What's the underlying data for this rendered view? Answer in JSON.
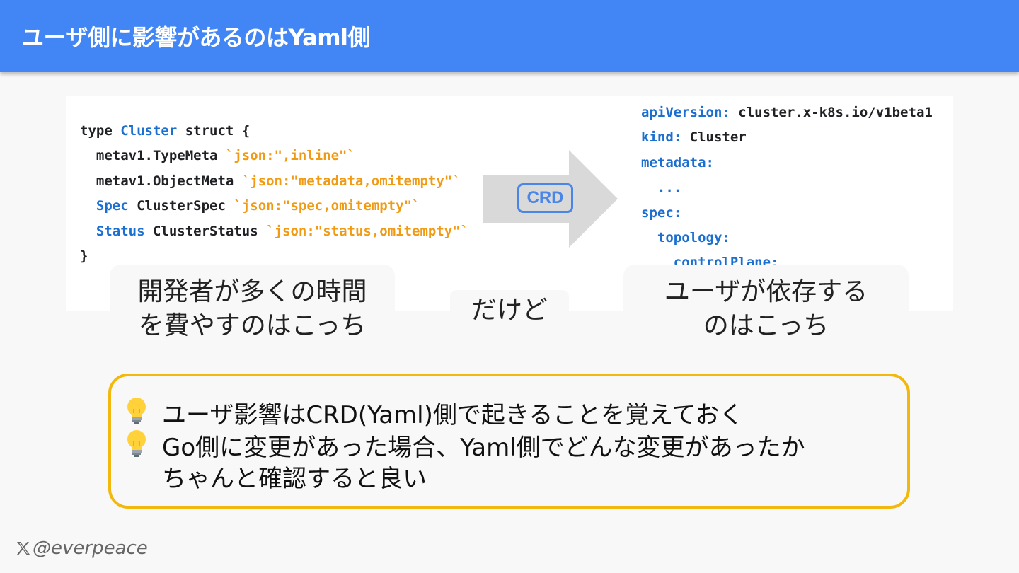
{
  "header": {
    "title": "ユーザ側に影響があるのはYaml側"
  },
  "go_code": {
    "line1": {
      "kw_type": "type ",
      "name": "Cluster",
      "rest": " struct {"
    },
    "line2": {
      "field": "  metav1.TypeMeta ",
      "tag": "`json:\",inline\"`"
    },
    "line3": {
      "field": "  metav1.ObjectMeta ",
      "tag": "`json:\"metadata,omitempty\"`"
    },
    "line4": {
      "indent": "  ",
      "name": "Spec",
      "type": " ClusterSpec ",
      "tag": "`json:\"spec,omitempty\"`"
    },
    "line5": {
      "indent": "  ",
      "name": "Status",
      "type": " ClusterStatus ",
      "tag": "`json:\"status,omitempty\"`"
    },
    "line6": "}"
  },
  "yaml_code": {
    "line1": {
      "key": "apiVersion:",
      "value": " cluster.x-k8s.io/v1beta1"
    },
    "line2": {
      "key": "kind:",
      "value": " Cluster"
    },
    "line3": {
      "key": "metadata:"
    },
    "line4": {
      "value": "  ..."
    },
    "line5": {
      "key": "spec:"
    },
    "line6": {
      "indent": "  ",
      "key": "topology:"
    },
    "line7": {
      "indent": "    ",
      "key": "controlPlane:"
    }
  },
  "arrow": {
    "label": "CRD",
    "color": "#d9d9d9",
    "label_color": "#4a86e8"
  },
  "bubbles": {
    "left": {
      "line1": "開発者が多くの時間",
      "line2": "を費やすのはこっち"
    },
    "middle": "だけど",
    "right": {
      "line1": "ユーザが依存する",
      "line2": "のはこっち"
    }
  },
  "notes": {
    "icon": "lightbulb-icon",
    "item1": "ユーザ影響はCRD(Yaml)側で起きることを覚えておく",
    "item2_line1": "Go側に変更があった場合、Yaml側でどんな変更があったか",
    "item2_line2": "ちゃんと確認すると良い",
    "border_color": "#f2b80d"
  },
  "footer": {
    "icon": "x-logo-icon",
    "handle": "@everpeace"
  },
  "colors": {
    "header": "#4285f4",
    "keyword": "#1a6fd1",
    "string": "#f09b13"
  }
}
